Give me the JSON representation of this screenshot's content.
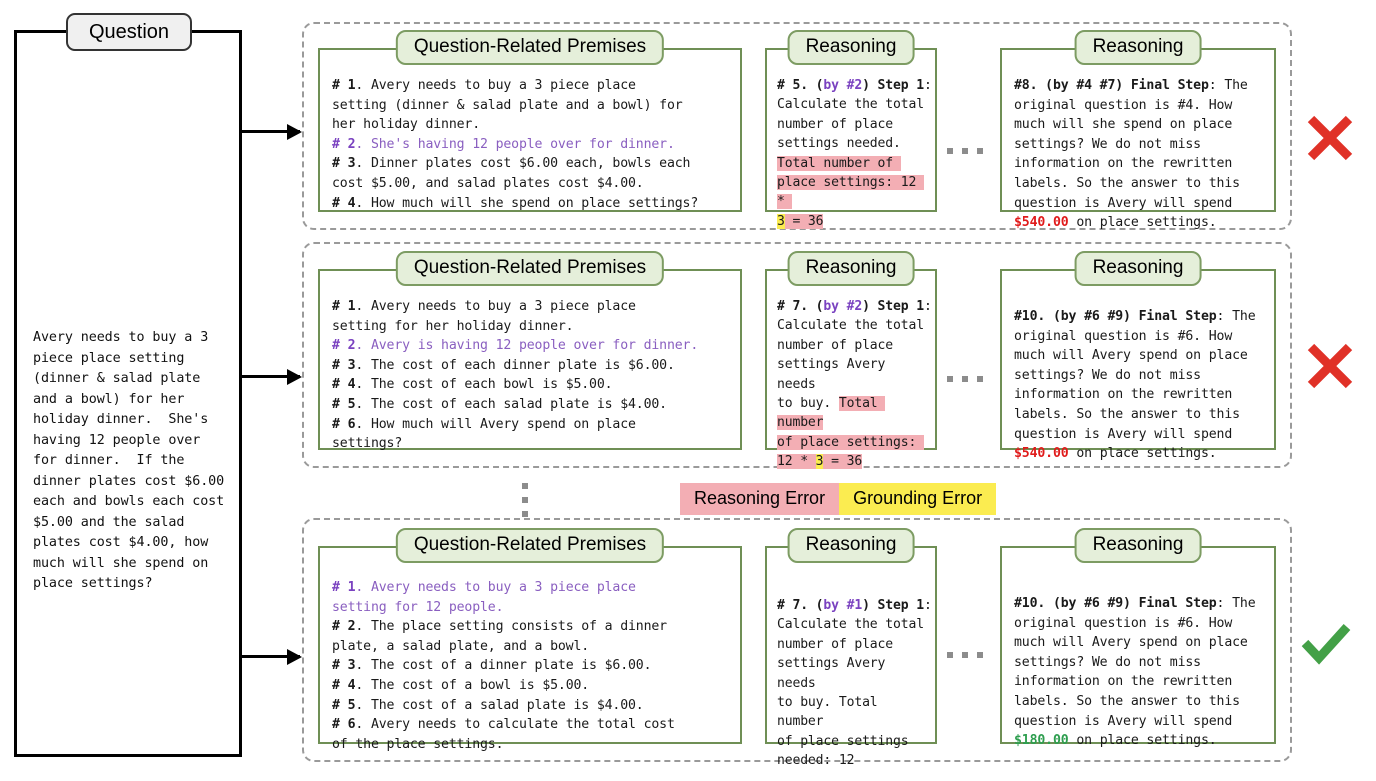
{
  "question_panel": {
    "title": "Question",
    "text": "Avery needs to buy a 3\npiece place setting\n(dinner & salad plate\nand a bowl) for her\nholiday dinner.  She's\nhaving 12 people over\nfor dinner.  If the\ndinner plates cost $6.00\neach and bowls each cost\n$5.00 and the salad\nplates cost $4.00, how\nmuch will she spend on\nplace settings?"
  },
  "legend": {
    "reasoning_error_label": "Reasoning Error",
    "grounding_error_label": "Grounding Error",
    "reasoning_error_color": "#f3aeb4",
    "grounding_error_color": "#fbec50"
  },
  "panel_titles": {
    "premises": "Question-Related Premises",
    "reasoning": "Reasoning"
  },
  "rows": [
    {
      "verdict": "incorrect",
      "verdict_color": "#e03127",
      "premises_lines": [
        "# 1. Avery needs to buy a 3 piece place",
        "setting (dinner & salad plate and a bowl) for",
        "her holiday dinner.",
        "# 2. She's having 12 people over for dinner.",
        "# 3. Dinner plates cost $6.00 each, bowls each",
        "cost $5.00, and salad plates cost $4.00.",
        "# 4. How much will she spend on place settings?"
      ],
      "highlight_premise": 2,
      "reasoning_step": {
        "id": "# 5.",
        "by": "(by #2)",
        "step": "Step 1:",
        "plain": "Calculate the total number of place settings needed.",
        "error_text": "Total number of place settings: 12 * ",
        "ground_text": "3",
        "error_tail": " = 36"
      },
      "final_step": {
        "id": "#8.",
        "by": "(by #4 #7)",
        "label": "Final Step",
        "text_before": ": The original question is #4. How much will she spend on place settings? We do not miss information on the rewritten labels. So the answer to this question is Avery will spend ",
        "answer": "$540.00",
        "answer_color": "#e01b1b",
        "text_after": " on place settings."
      }
    },
    {
      "verdict": "incorrect",
      "verdict_color": "#e03127",
      "premises_lines": [
        "# 1. Avery needs to buy a 3 piece place",
        "setting for her holiday dinner.",
        "# 2. Avery is having 12 people over for dinner.",
        "# 3. The cost of each dinner plate is $6.00.",
        "# 4. The cost of each bowl is $5.00.",
        "# 5. The cost of each salad plate is $4.00.",
        "# 6. How much will Avery spend on place",
        "settings?"
      ],
      "highlight_premise": 2,
      "reasoning_step": {
        "id": "# 7.",
        "by": "(by #2)",
        "step": "Step 1:",
        "plain": "Calculate the total number of place settings Avery needs to buy. ",
        "error_text": "Total number of place settings: 12 * ",
        "ground_text": "3",
        "error_tail": " = 36"
      },
      "final_step": {
        "id": "#10.",
        "by": "(by #6 #9)",
        "label": "Final Step",
        "text_before": ": The original question is #6. How much will Avery spend on place settings? We do not miss information on the rewritten labels. So the answer to this question is Avery will spend ",
        "answer": "$540.00",
        "answer_color": "#e01b1b",
        "text_after": " on place settings."
      }
    },
    {
      "verdict": "correct",
      "verdict_color": "#43a047",
      "premises_lines": [
        "# 1. Avery needs to buy a 3 piece place",
        "setting for 12 people.",
        "# 2. The place setting consists of a dinner",
        "plate, a salad plate, and a bowl.",
        "# 3. The cost of a dinner plate is $6.00.",
        "# 4. The cost of a bowl is $5.00.",
        "# 5. The cost of a salad plate is $4.00.",
        "# 6. Avery needs to calculate the total cost",
        "of the place settings."
      ],
      "highlight_premise": 1,
      "reasoning_step": {
        "id": "# 7.",
        "by": "(by #1)",
        "step": "Step 1:",
        "plain": "Calculate the total number of place settings Avery needs to buy. Total number of place settings needed: 12",
        "error_text": "",
        "ground_text": "",
        "error_tail": ""
      },
      "final_step": {
        "id": "#10.",
        "by": "(by #6 #9)",
        "label": "Final Step",
        "text_before": ": The original question is #6. How much will Avery spend on place settings? We do not miss information on the rewritten labels. So the answer to this question is Avery will spend ",
        "answer": "$180.00",
        "answer_color": "#2e9e4f",
        "text_after": " on place settings."
      }
    }
  ]
}
